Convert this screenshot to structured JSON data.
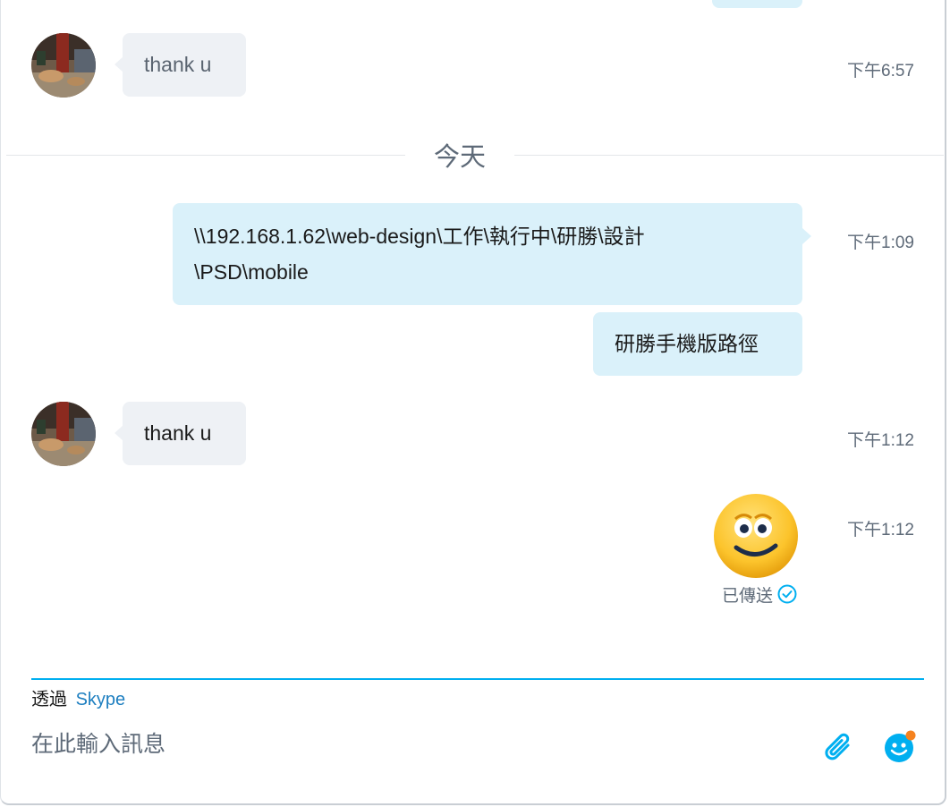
{
  "conversation": {
    "day_divider": "今天",
    "messages": [
      {
        "id": "m1",
        "direction": "incoming",
        "text": "thank u",
        "time": "下午6:57",
        "text_color": "#5a6470"
      },
      {
        "id": "m2",
        "direction": "outgoing",
        "text_line1": "\\\\192.168.1.62\\web-design\\工作\\執行中\\研勝\\設計",
        "text_line2": "\\PSD\\mobile",
        "time": "下午1:09"
      },
      {
        "id": "m3",
        "direction": "outgoing",
        "text": "研勝手機版路徑"
      },
      {
        "id": "m4",
        "direction": "incoming",
        "text": "thank u",
        "time": "下午1:12"
      },
      {
        "id": "m5",
        "direction": "outgoing",
        "type": "emoticon",
        "emoticon": "smile-emoticon",
        "time": "下午1:12",
        "status": "已傳送",
        "status_icon": "check-circle-icon"
      }
    ]
  },
  "composer": {
    "via_prefix": "透過",
    "via_service": "Skype",
    "placeholder": "在此輸入訊息",
    "attach_icon": "paperclip-icon",
    "emoji_icon": "emoji-icon"
  },
  "colors": {
    "outgoing_bubble": "#daf1fa",
    "incoming_bubble": "#eef1f5",
    "accent": "#00aff0",
    "skype_link": "#1e7fc0",
    "notification_dot": "#f5821f"
  }
}
